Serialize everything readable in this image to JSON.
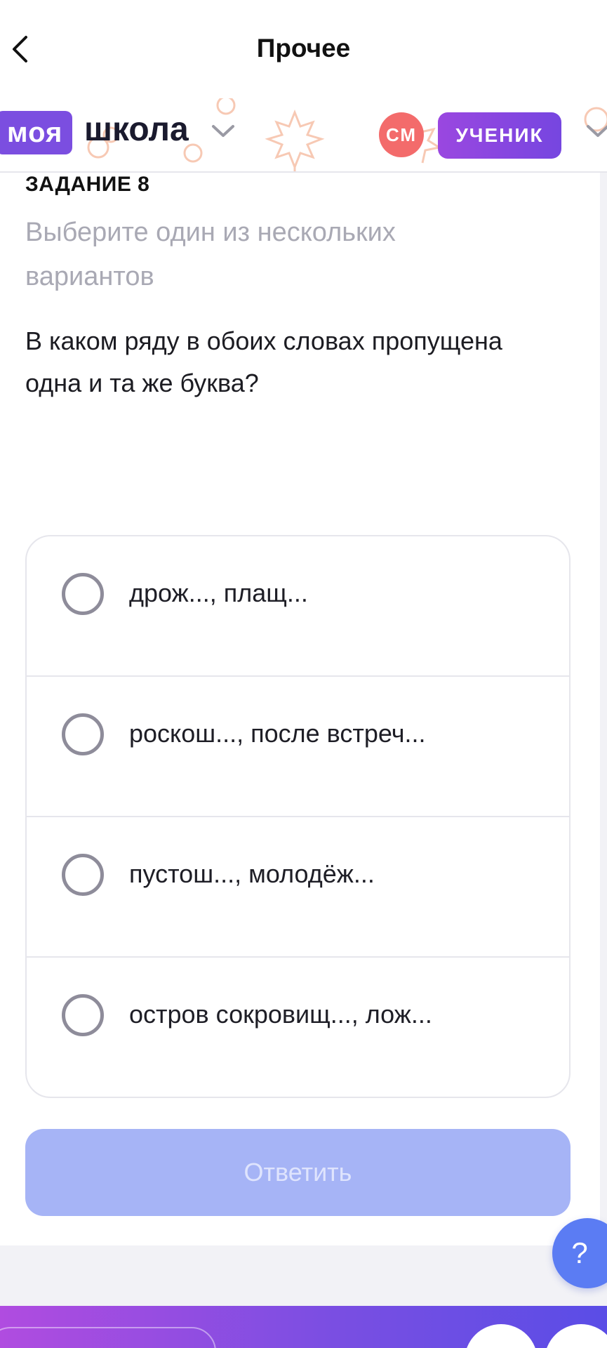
{
  "nav": {
    "title": "Прочее",
    "back_icon": "chevron-left-icon"
  },
  "header": {
    "logo_box": "моя",
    "logo_word": "школа",
    "avatar_initials": "СМ",
    "role": "УЧЕНИК",
    "colors": {
      "brand": "#7b4ee0",
      "avatar": "#f36b6b",
      "role_badge": "#8e48e0"
    }
  },
  "task": {
    "number_label": "ЗАДАНИЕ 8",
    "hint": "Выберите один из нескольких вариантов",
    "question": "В каком ряду в обоих словах пропущена одна и та же буква?",
    "options": [
      {
        "text": "дрож..., плащ...",
        "selected": false
      },
      {
        "text": "роскош..., после встреч...",
        "selected": false
      },
      {
        "text": "пустош..., молодёж...",
        "selected": false
      },
      {
        "text": "остров сокровищ..., лож...",
        "selected": false
      }
    ],
    "submit_label": "Ответить",
    "submit_enabled": false
  },
  "help": {
    "label": "?"
  }
}
